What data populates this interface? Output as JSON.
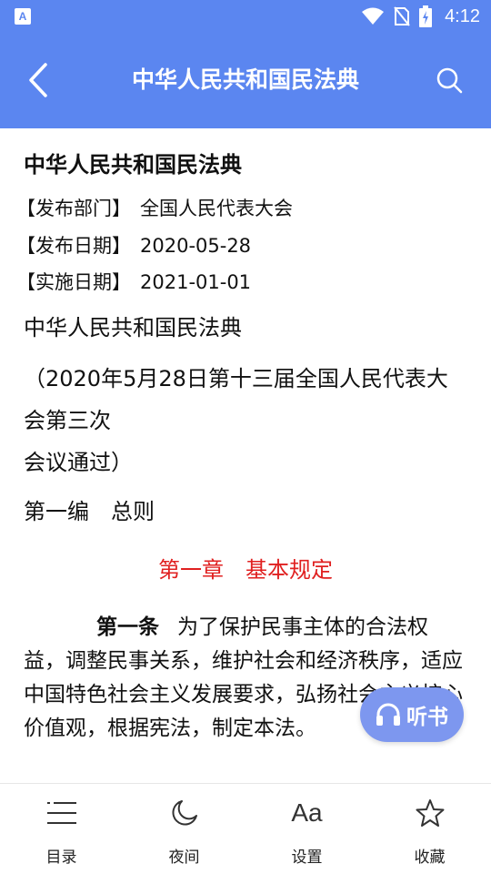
{
  "status_bar": {
    "app_badge": "A",
    "time": "4:12"
  },
  "app_bar": {
    "title": "中华人民共和国民法典"
  },
  "doc": {
    "title": "中华人民共和国民法典",
    "meta": [
      {
        "label": "【发布部门】",
        "value": "全国人民代表大会"
      },
      {
        "label": "【发布日期】",
        "value": "2020-05-28"
      },
      {
        "label": "【实施日期】",
        "value": "2021-01-01"
      }
    ],
    "heading": "中华人民共和国民法典",
    "adoption_line1": "（2020年5月28日第十三届全国人民代表大会第三次",
    "adoption_line2": "会议通过）",
    "part": "第一编　总则",
    "chapter": "第一章　基本规定",
    "article_no": "第一条",
    "article_text": "为了保护民事主体的合法权益，调整民事关系，维护社会和经济秩序，适应中国特色社会主义发展要求，弘扬社会主义核心价值观，根据宪法，制定本法。"
  },
  "listen_button": {
    "label": "听书",
    "icon": "headphones-icon"
  },
  "bottom_nav": [
    {
      "label": "目录",
      "icon": "list-icon"
    },
    {
      "label": "夜间",
      "icon": "moon-icon"
    },
    {
      "label": "设置",
      "icon": "font-size-icon",
      "icon_text": "Aa"
    },
    {
      "label": "收藏",
      "icon": "star-icon"
    }
  ],
  "colors": {
    "primary": "#5b86f0",
    "chapter_red": "#e02020",
    "listen_button": "#7d97ef"
  }
}
